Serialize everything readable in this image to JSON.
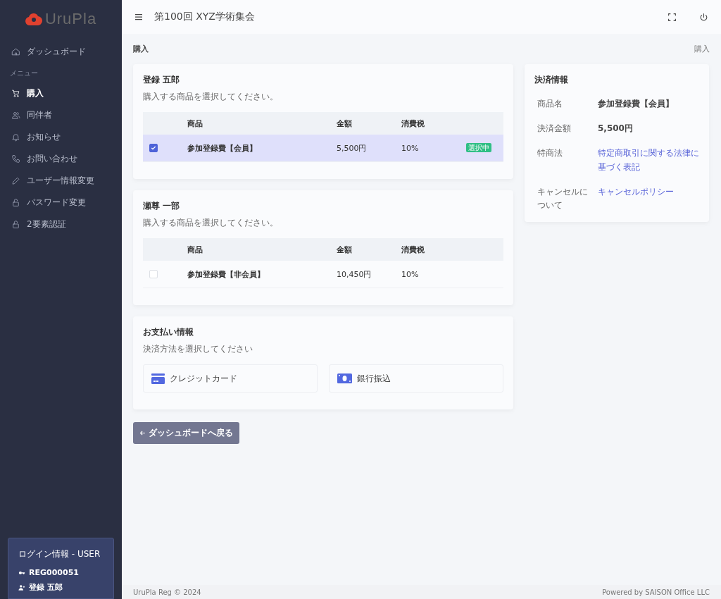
{
  "sidebar": {
    "logo": "UruPla",
    "items": [
      {
        "label": "ダッシュボード",
        "selected": false
      }
    ],
    "section_label": "メニュー",
    "menu": [
      {
        "label": "購入",
        "selected": true
      },
      {
        "label": "同伴者",
        "selected": false
      },
      {
        "label": "お知らせ",
        "selected": false
      },
      {
        "label": "お問い合わせ",
        "selected": false
      },
      {
        "label": "ユーザー情報変更",
        "selected": false
      },
      {
        "label": "パスワード変更",
        "selected": false
      },
      {
        "label": "2要素認証",
        "selected": false
      }
    ],
    "login_info": {
      "title": "ログイン情報 - USER",
      "id": "REG000051",
      "name": "登録 五郎"
    }
  },
  "header": {
    "title": "第100回 XYZ学術集会"
  },
  "page": {
    "title": "購入",
    "breadcrumb": "購入"
  },
  "purchasers": [
    {
      "name": "登録 五郎",
      "instruction": "購入する商品を選択してください。",
      "columns": [
        "商品",
        "金額",
        "消費税"
      ],
      "rows": [
        {
          "product": "参加登録費【会員】",
          "price": "5,500円",
          "tax": "10%",
          "checked": true,
          "selected": true,
          "badge": "選択中"
        }
      ]
    },
    {
      "name": "瀬尊 一部",
      "instruction": "購入する商品を選択してください。",
      "columns": [
        "商品",
        "金額",
        "消費税"
      ],
      "rows": [
        {
          "product": "参加登録費【非会員】",
          "price": "10,450円",
          "tax": "10%",
          "checked": false,
          "selected": false
        }
      ]
    }
  ],
  "payment": {
    "title": "お支払い情報",
    "instruction": "決済方法を選択してください",
    "methods": [
      {
        "kind": "card",
        "label": "クレジットカード"
      },
      {
        "kind": "bank",
        "label": "銀行振込"
      }
    ]
  },
  "back_button": "ダッシュボードへ戻る",
  "summary": {
    "title": "決済情報",
    "rows": [
      {
        "label": "商品名",
        "value": "参加登録費【会員】",
        "kind": "text"
      },
      {
        "label": "決済金額",
        "value": "5,500円",
        "kind": "text"
      },
      {
        "label": "特商法",
        "value": "特定商取引に関する法律に基づく表記",
        "kind": "link"
      },
      {
        "label": "キャンセルについて",
        "value": "キャンセルポリシー",
        "kind": "link"
      }
    ]
  },
  "footer": {
    "left": "UruPla Reg © 2024",
    "right": "Powered by SAISON Office LLC"
  }
}
